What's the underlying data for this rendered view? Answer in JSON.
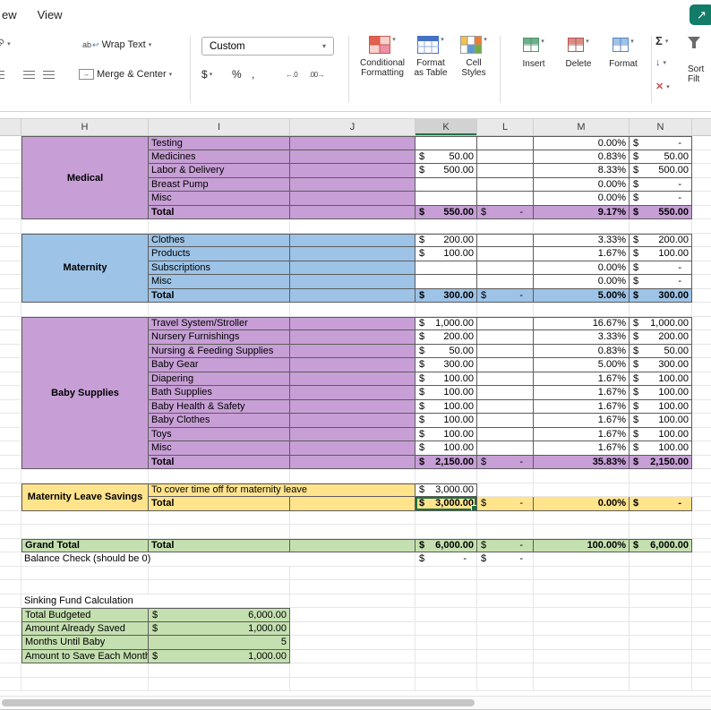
{
  "colors": {
    "section_purple": "#C79FD6",
    "section_blue": "#9DC3E6",
    "section_yellow": "#FFE48C",
    "total_green": "#C5E0B0",
    "selection_green": "#1E7145",
    "share_teal": "#127C68"
  },
  "icons": {
    "share": "↗",
    "orientation_ab": "ab",
    "wrap_ab": "ab",
    "wrap_arrow": "↩",
    "merge_arrows": "↔",
    "chevron": "▾",
    "currency_button": "$",
    "percent_button": "%",
    "comma_button": ",",
    "decrease_decimal": "←.0",
    "increase_decimal": ".00→",
    "sum": "Σ",
    "fill": "↓",
    "clear": "✕"
  },
  "ribbon": {
    "tabs": [
      "ew",
      "View"
    ],
    "alignment_group": {
      "wrap_text": "Wrap Text",
      "merge_center": "Merge & Center"
    },
    "number_group": {
      "format_value": "Custom"
    },
    "styles_group": {
      "conditional_1": "Conditional",
      "conditional_2": "Formatting",
      "table_1": "Format",
      "table_2": "as Table",
      "styles_1": "Cell",
      "styles_2": "Styles"
    },
    "cells_group": {
      "insert": "Insert",
      "delete": "Delete",
      "format": "Format"
    },
    "editing_group": {
      "sort_1": "Sort",
      "sort_2": "Filt"
    }
  },
  "sheet": {
    "columns": [
      "H",
      "I",
      "J",
      "K",
      "L",
      "M",
      "N"
    ],
    "selected_column": "K",
    "currency": "$",
    "sections": [
      {
        "header": "Medical",
        "color": "section_purple",
        "items": [
          {
            "label": "Testing",
            "k": null,
            "m": "0.00%",
            "n": "-"
          },
          {
            "label": "Medicines",
            "k": "50.00",
            "m": "0.83%",
            "n": "50.00"
          },
          {
            "label": "Labor & Delivery",
            "k": "500.00",
            "m": "8.33%",
            "n": "500.00"
          },
          {
            "label": "Breast Pump",
            "k": null,
            "m": "0.00%",
            "n": "-"
          },
          {
            "label": "Misc",
            "k": null,
            "m": "0.00%",
            "n": "-"
          }
        ],
        "total": {
          "label": "Total",
          "k": "550.00",
          "l": "-",
          "m": "9.17%",
          "n": "550.00"
        }
      },
      {
        "header": "Maternity",
        "color": "section_blue",
        "items": [
          {
            "label": "Clothes",
            "k": "200.00",
            "m": "3.33%",
            "n": "200.00"
          },
          {
            "label": "Products",
            "k": "100.00",
            "m": "1.67%",
            "n": "100.00"
          },
          {
            "label": "Subscriptions",
            "k": null,
            "m": "0.00%",
            "n": "-"
          },
          {
            "label": "Misc",
            "k": null,
            "m": "0.00%",
            "n": "-"
          }
        ],
        "total": {
          "label": "Total",
          "k": "300.00",
          "l": "-",
          "m": "5.00%",
          "n": "300.00"
        }
      },
      {
        "header": "Baby Supplies",
        "color": "section_purple",
        "items": [
          {
            "label": "Travel System/Stroller",
            "k": "1,000.00",
            "m": "16.67%",
            "n": "1,000.00"
          },
          {
            "label": "Nursery Furnishings",
            "k": "200.00",
            "m": "3.33%",
            "n": "200.00"
          },
          {
            "label": "Nursing & Feeding Supplies",
            "k": "50.00",
            "m": "0.83%",
            "n": "50.00"
          },
          {
            "label": "Baby Gear",
            "k": "300.00",
            "m": "5.00%",
            "n": "300.00"
          },
          {
            "label": "Diapering",
            "k": "100.00",
            "m": "1.67%",
            "n": "100.00"
          },
          {
            "label": "Bath Supplies",
            "k": "100.00",
            "m": "1.67%",
            "n": "100.00"
          },
          {
            "label": "Baby Health & Safety",
            "k": "100.00",
            "m": "1.67%",
            "n": "100.00"
          },
          {
            "label": "Baby Clothes",
            "k": "100.00",
            "m": "1.67%",
            "n": "100.00"
          },
          {
            "label": "Toys",
            "k": "100.00",
            "m": "1.67%",
            "n": "100.00"
          },
          {
            "label": "Misc",
            "k": "100.00",
            "m": "1.67%",
            "n": "100.00"
          }
        ],
        "total": {
          "label": "Total",
          "k": "2,150.00",
          "l": "-",
          "m": "35.83%",
          "n": "2,150.00"
        }
      },
      {
        "header": "Maternity Leave Savings",
        "color": "section_yellow",
        "items": [
          {
            "label": "To cover time off for maternity leave",
            "k": "3,000.00",
            "m": null,
            "n": null,
            "merged_label": true
          }
        ],
        "total": {
          "label": "Total",
          "k": "3,000.00",
          "l": "-",
          "m": "0.00%",
          "n": "-",
          "selected": true
        }
      }
    ],
    "grand_total": {
      "h": "Grand Total",
      "label": "Total",
      "k": "6,000.00",
      "l": "-",
      "m": "100.00%",
      "n": "6,000.00"
    },
    "balance_check": {
      "label": "Balance Check (should be 0)",
      "k": "-",
      "l": "-"
    },
    "sinking_fund": {
      "title": "Sinking Fund Calculation",
      "rows": [
        {
          "label": "Total Budgeted",
          "currency": true,
          "value": "6,000.00"
        },
        {
          "label": "Amount Already Saved",
          "currency": true,
          "value": "1,000.00"
        },
        {
          "label": "Months Until Baby",
          "currency": false,
          "value": "5"
        },
        {
          "label": "Amount to Save Each Month",
          "currency": true,
          "value": "1,000.00"
        }
      ]
    }
  }
}
